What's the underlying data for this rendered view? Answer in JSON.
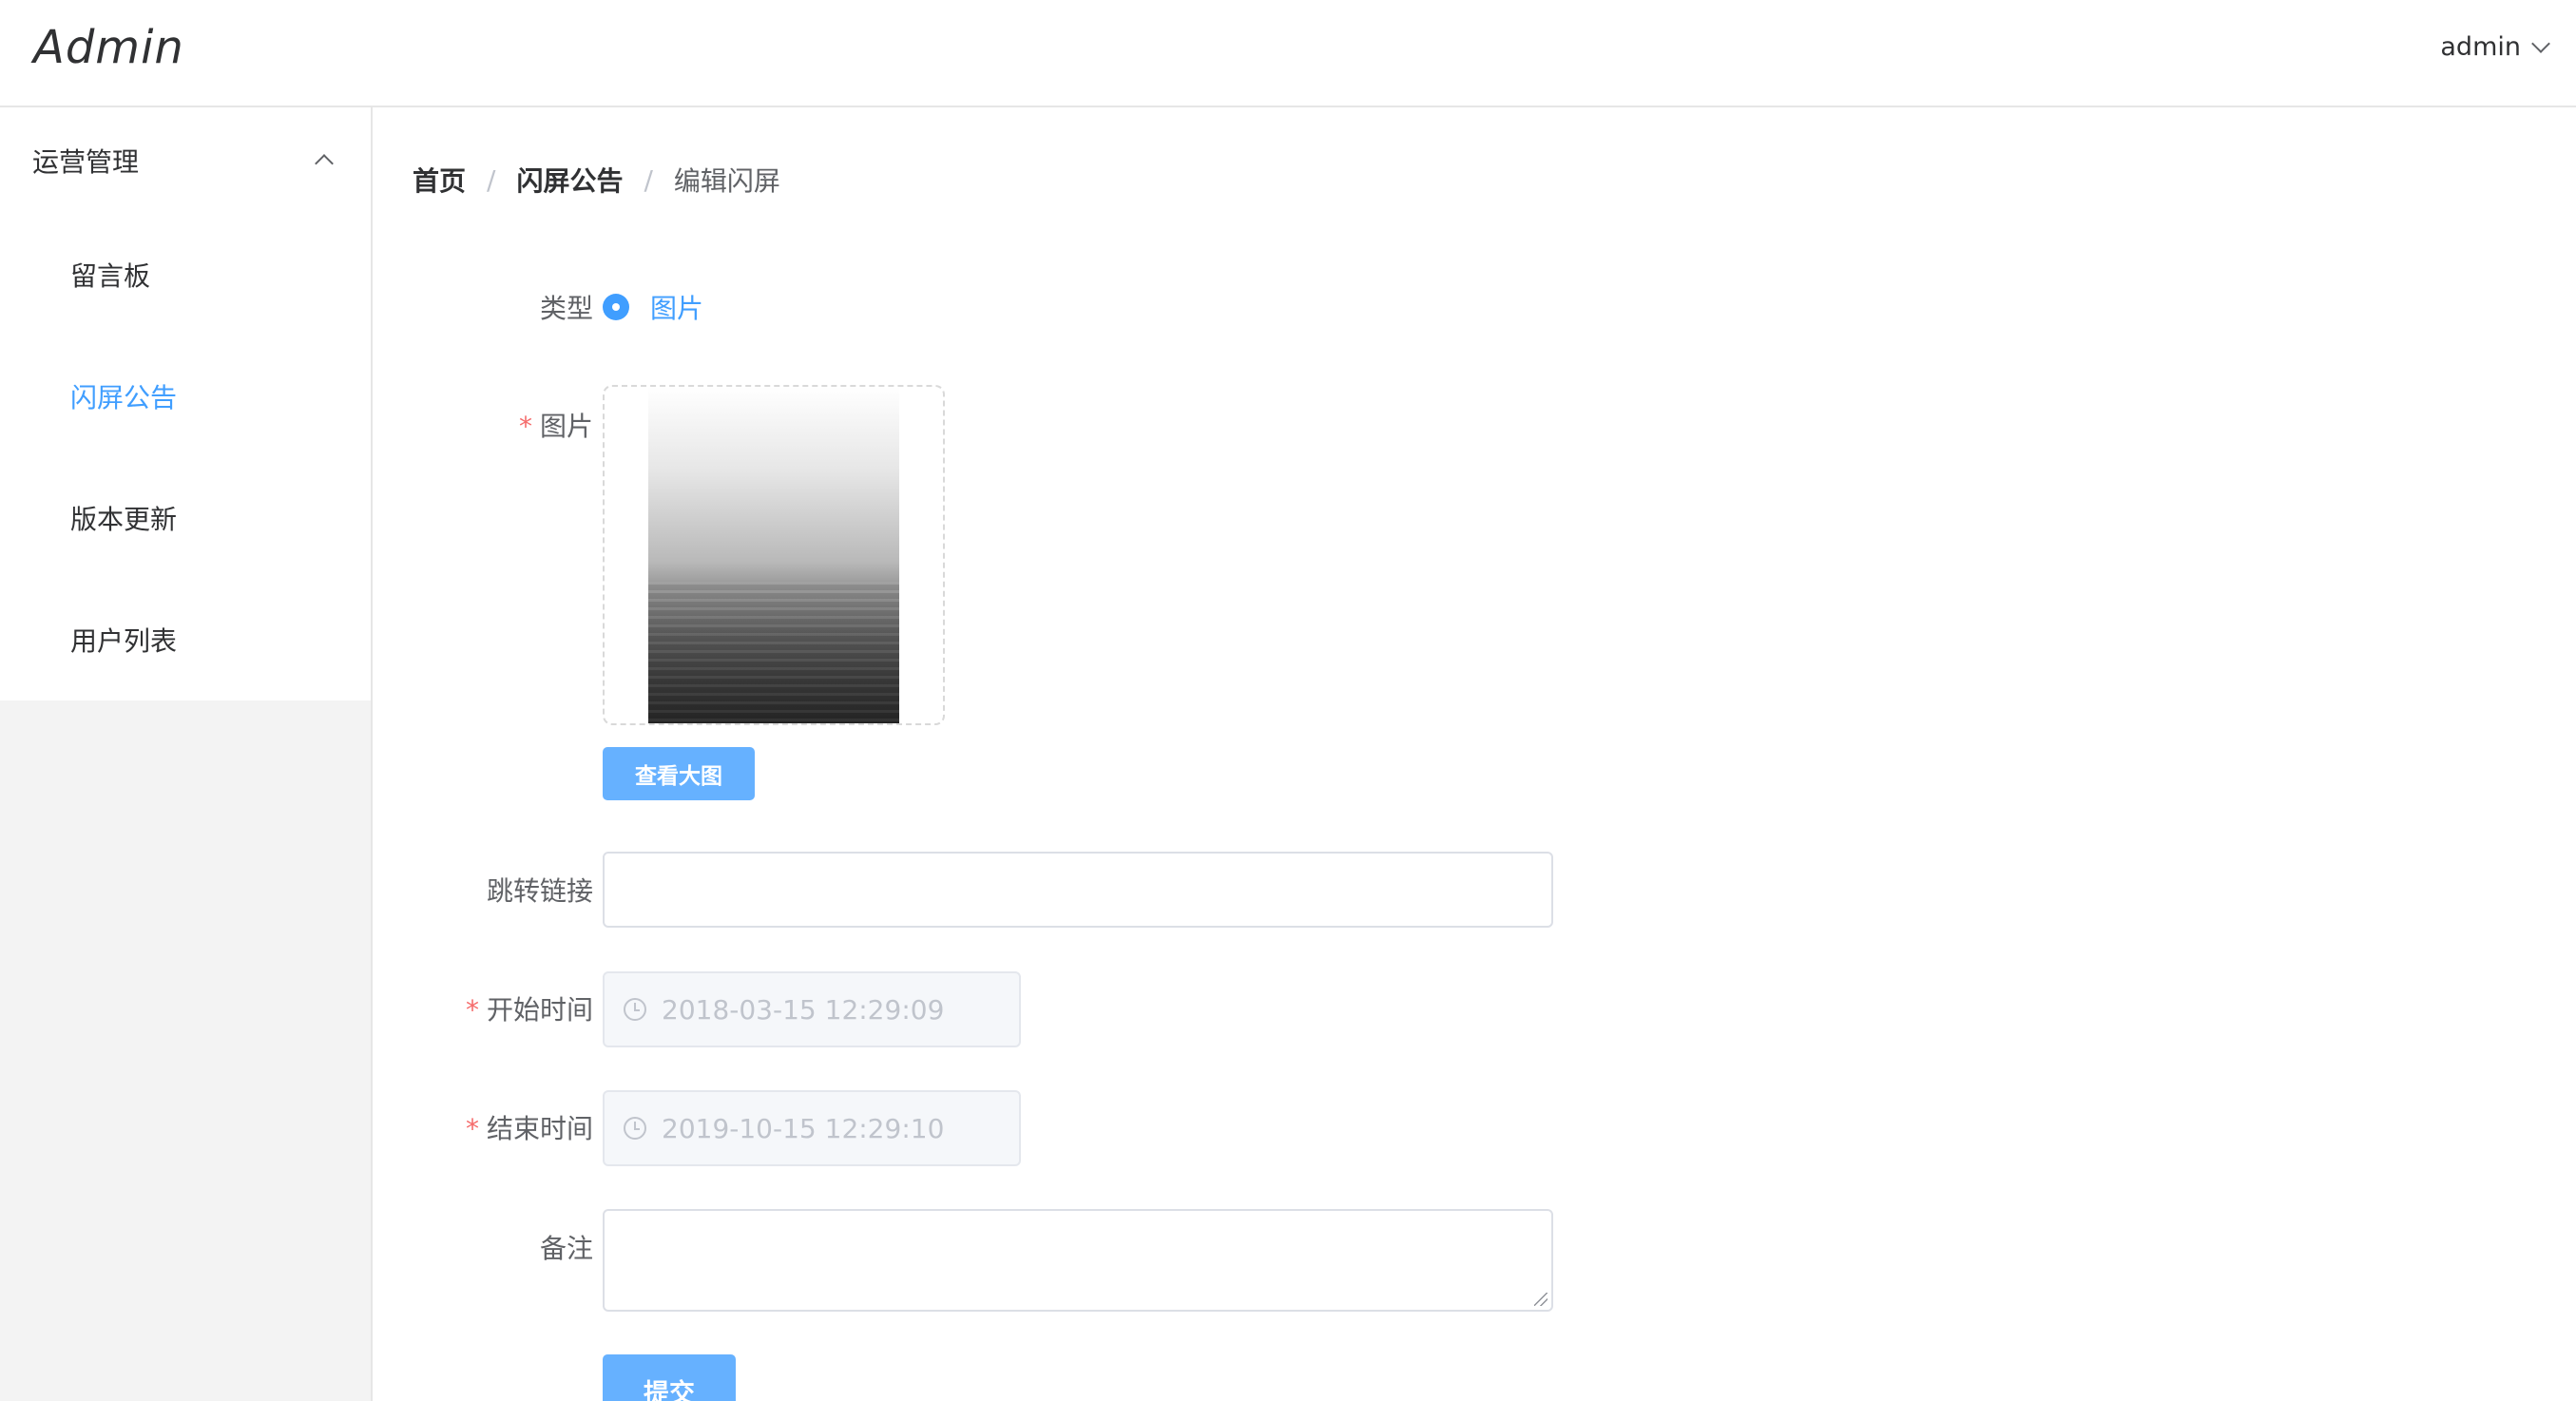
{
  "header": {
    "logo": "Admin",
    "user": "admin"
  },
  "sidebar": {
    "group_title": "运营管理",
    "items": [
      {
        "label": "留言板",
        "active": false
      },
      {
        "label": "闪屏公告",
        "active": true
      },
      {
        "label": "版本更新",
        "active": false
      },
      {
        "label": "用户列表",
        "active": false
      }
    ]
  },
  "breadcrumb": {
    "items": [
      "首页",
      "闪屏公告",
      "编辑闪屏"
    ],
    "separator": "/"
  },
  "form": {
    "type_label": "类型",
    "type_option": "图片",
    "image_label": "图片",
    "view_large_button": "查看大图",
    "link_label": "跳转链接",
    "link_value": "",
    "start_label": "开始时间",
    "start_value": "2018-03-15 12:29:09",
    "end_label": "结束时间",
    "end_value": "2019-10-15 12:29:10",
    "remark_label": "备注",
    "remark_value": "",
    "required_mark": "*",
    "submit_button": "提交"
  },
  "colors": {
    "primary": "#409eff",
    "required": "#f56c6c"
  }
}
